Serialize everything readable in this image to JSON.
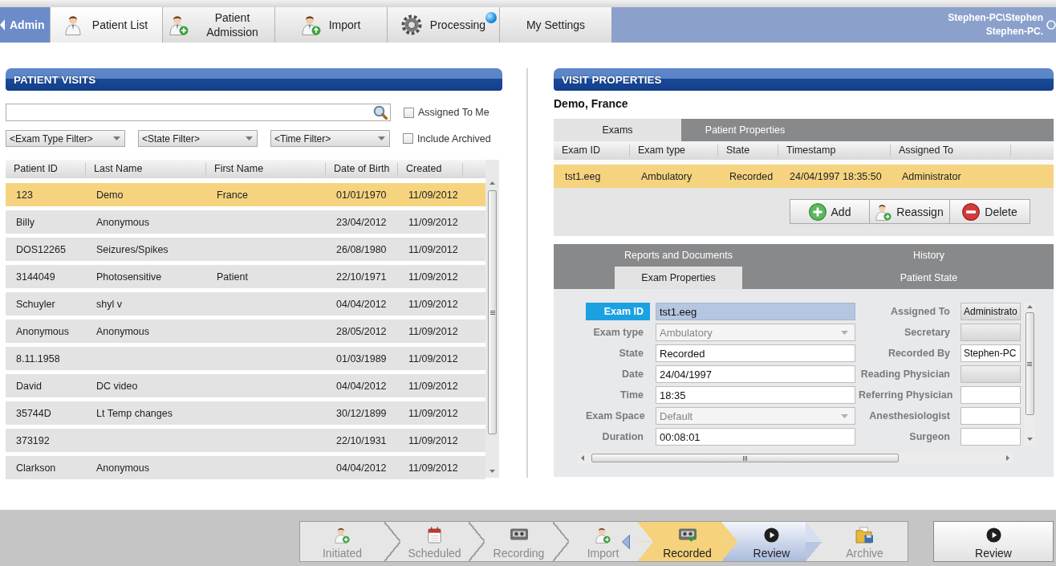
{
  "nav": {
    "admin": {
      "label": "Admin"
    },
    "tabs": [
      {
        "label": "Patient List",
        "kind": "list",
        "selected": true,
        "badge": false
      },
      {
        "label": "Patient Admission",
        "kind": "admission",
        "selected": false,
        "badge": false
      },
      {
        "label": "Import",
        "kind": "import",
        "selected": false,
        "badge": false
      },
      {
        "label": "Processing",
        "kind": "processing",
        "selected": false,
        "badge": true
      },
      {
        "label": "My Settings",
        "kind": "settings",
        "selected": false,
        "badge": false
      }
    ],
    "user": {
      "account": "Stephen-PC\\Stephen",
      "name": "Stephen-PC."
    }
  },
  "patient_visits": {
    "title": "PATIENT VISITS",
    "filters": [
      {
        "label": "<Exam Type Filter>"
      },
      {
        "label": "<State Filter>"
      },
      {
        "label": "<Time Filter>"
      }
    ],
    "options": [
      {
        "label": "Assigned To Me",
        "checked": false
      },
      {
        "label": "Include Archived",
        "checked": false
      }
    ],
    "table": {
      "columns": [
        "Patient ID",
        "Last Name",
        "First Name",
        "Date of Birth",
        "Created"
      ],
      "rows": [
        {
          "patient_id": "123",
          "last_name": "Demo",
          "first_name": "France",
          "date_of_birth": "01/01/1970",
          "created": "11/09/2012",
          "selected": true
        },
        {
          "patient_id": "Billy",
          "last_name": "Anonymous",
          "date_of_birth": "23/04/2012",
          "created": "11/09/2012",
          "selected": false
        },
        {
          "patient_id": "DOS12265",
          "last_name": "Seizures/Spikes",
          "date_of_birth": "26/08/1980",
          "created": "11/09/2012",
          "selected": false
        },
        {
          "patient_id": "3144049",
          "last_name": "Photosensitive",
          "first_name": "Patient",
          "date_of_birth": "22/10/1971",
          "created": "11/09/2012",
          "selected": false
        },
        {
          "patient_id": "Schuyler",
          "last_name": "shyl v",
          "date_of_birth": "04/04/2012",
          "created": "11/09/2012",
          "selected": false
        },
        {
          "patient_id": "Anonymous",
          "last_name": "Anonymous",
          "date_of_birth": "28/05/2012",
          "created": "11/09/2012",
          "selected": false
        },
        {
          "patient_id": "8.11.1958",
          "date_of_birth": "01/03/1989",
          "created": "11/09/2012",
          "selected": false
        },
        {
          "patient_id": "David",
          "last_name": "DC video",
          "date_of_birth": "04/04/2012",
          "created": "11/09/2012",
          "selected": false
        },
        {
          "patient_id": "35744D",
          "last_name": "Lt Temp changes",
          "date_of_birth": "30/12/1899",
          "created": "11/09/2012",
          "selected": false
        },
        {
          "patient_id": "373192",
          "date_of_birth": "22/10/1931",
          "created": "11/09/2012",
          "selected": false
        },
        {
          "patient_id": "Clarkson",
          "last_name": "Anonymous",
          "date_of_birth": "04/04/2012",
          "created": "11/09/2012",
          "selected": false
        }
      ]
    }
  },
  "visit_properties": {
    "title": "VISIT PROPERTIES",
    "patient": "Demo, France",
    "tabs": [
      {
        "label": "Exams",
        "selected": true
      },
      {
        "label": "Patient Properties",
        "selected": false
      }
    ],
    "exams": {
      "columns": [
        "Exam ID",
        "Exam type",
        "State",
        "Timestamp",
        "Assigned To"
      ],
      "rows": [
        {
          "exam_id": "tst1.eeg",
          "exam_type": "Ambulatory",
          "state": "Recorded",
          "timestamp": "24/04/1997 18:35:50",
          "assigned_to": "Administrator",
          "selected": true
        }
      ]
    },
    "buttons": [
      {
        "label": "Add",
        "kind": "add"
      },
      {
        "label": "Reassign",
        "kind": "reassign"
      },
      {
        "label": "Delete",
        "kind": "delete"
      }
    ],
    "detail_tabs": [
      {
        "tabs": [
          {
            "label": "Reports and Documents",
            "selected": false
          },
          {
            "label": "History",
            "selected": false
          }
        ]
      },
      {
        "tabs": [
          {
            "label": "Exam Properties",
            "selected": true
          },
          {
            "label": "Patient State",
            "selected": false
          }
        ]
      }
    ],
    "exam_properties": {
      "left": [
        {
          "label": "Exam ID",
          "kind": "text",
          "value": "tst1.eeg",
          "focused": true,
          "disabled": false
        },
        {
          "label": "Exam type",
          "kind": "dropdown",
          "value": "Ambulatory",
          "focused": false,
          "disabled": true
        },
        {
          "label": "State",
          "kind": "text",
          "value": "Recorded",
          "focused": false,
          "disabled": false
        },
        {
          "label": "Date",
          "kind": "text",
          "value": "24/04/1997",
          "focused": false,
          "disabled": false
        },
        {
          "label": "Time",
          "kind": "text",
          "value": "18:35",
          "focused": false,
          "disabled": false
        },
        {
          "label": "Exam Space",
          "kind": "dropdown",
          "value": "Default",
          "focused": false,
          "disabled": true
        },
        {
          "label": "Duration",
          "kind": "text",
          "value": "00:08:01",
          "focused": false,
          "disabled": false
        }
      ],
      "right": [
        {
          "label": "Assigned To",
          "kind": "combo",
          "value": "Administrato"
        },
        {
          "label": "Secretary",
          "kind": "combo"
        },
        {
          "label": "Recorded By",
          "kind": "text",
          "value": "Stephen-PC"
        },
        {
          "label": "Reading Physician",
          "kind": "combo"
        },
        {
          "label": "Referring Physician",
          "kind": "text"
        },
        {
          "label": "Anesthesiologist",
          "kind": "text"
        },
        {
          "label": "Surgeon",
          "kind": "text"
        }
      ]
    }
  },
  "workflow": {
    "steps": [
      {
        "label": "Initiated",
        "kind": "initiated",
        "selected": false,
        "highlighted": false,
        "marker": false
      },
      {
        "label": "Scheduled",
        "kind": "scheduled",
        "selected": false,
        "highlighted": false,
        "marker": false
      },
      {
        "label": "Recording",
        "kind": "recording",
        "selected": false,
        "highlighted": false,
        "marker": false
      },
      {
        "label": "Import",
        "kind": "import",
        "selected": false,
        "highlighted": false,
        "marker": true
      },
      {
        "label": "Recorded",
        "kind": "recorded",
        "selected": true,
        "highlighted": false,
        "marker": false
      },
      {
        "label": "Review",
        "kind": "review",
        "selected": false,
        "highlighted": true,
        "marker": false
      },
      {
        "label": "Archive",
        "kind": "archive",
        "selected": false,
        "highlighted": false,
        "marker": false
      }
    ],
    "action": {
      "label": "Review"
    }
  }
}
